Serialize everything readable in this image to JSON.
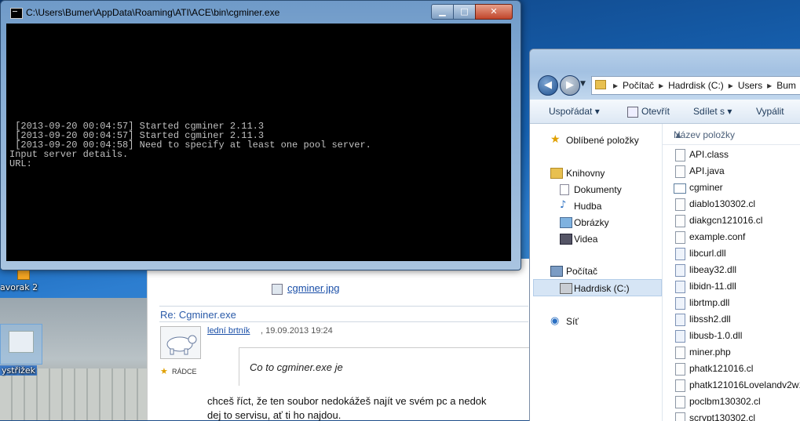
{
  "console": {
    "title": "C:\\Users\\Bumer\\AppData\\Roaming\\ATI\\ACE\\bin\\cgminer.exe",
    "lines": [
      " [2013-09-20 00:04:57] Started cgminer 2.11.3",
      " [2013-09-20 00:04:57] Started cgminer 2.11.3",
      " [2013-09-20 00:04:58] Need to specify at least one pool server.",
      "Input server details.",
      "URL:"
    ]
  },
  "desktop": {
    "icon_label_1": "avorak 2",
    "icon_label_2": "ystřižek"
  },
  "browser_page": {
    "attachment": "cgminer.jpg",
    "reply_title": "Re: Cgminer.exe",
    "author": "lední brtník",
    "date": ", 19.09.2013 19:24",
    "rank": "RÁDCE",
    "quote": "Co to cgminer.exe je",
    "body_line_1": "chceš říct, že ten soubor nedokážeš najít ve svém pc a nedok",
    "body_line_2": "dej to servisu, ať ti ho najdou."
  },
  "explorer": {
    "address": [
      "Počítač",
      "Hadrdisk (C:)",
      "Users",
      "Bum"
    ],
    "toolbar": {
      "organize": "Uspořádat ▾",
      "open": "Otevřít",
      "share": "Sdílet s ▾",
      "burn": "Vypálit"
    },
    "nav": {
      "favorites": "Oblíbené položky",
      "libraries": "Knihovny",
      "documents": "Dokumenty",
      "music": "Hudba",
      "pictures": "Obrázky",
      "videos": "Videa",
      "computer": "Počítač",
      "hdd": "Hadrdisk (C:)",
      "network": "Síť"
    },
    "column_header": "Název položky",
    "files": [
      "API.class",
      "API.java",
      "cgminer",
      "diablo130302.cl",
      "diakgcn121016.cl",
      "example.conf",
      "libcurl.dll",
      "libeay32.dll",
      "libidn-11.dll",
      "librtmp.dll",
      "libssh2.dll",
      "libusb-1.0.dll",
      "miner.php",
      "phatk121016.cl",
      "phatk121016Lovelandv2w1",
      "poclbm130302.cl",
      "scrypt130302.cl"
    ]
  }
}
